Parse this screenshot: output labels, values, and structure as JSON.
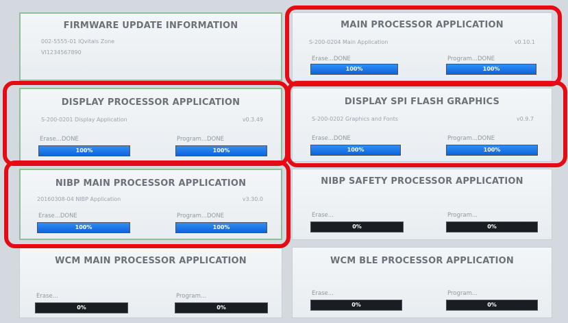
{
  "panels": [
    {
      "id": "firmware",
      "title": "FIRMWARE UPDATE INFORMATION",
      "line1": "002-5555-01 IQvitals Zone",
      "line2": "VI1234567890"
    },
    {
      "id": "main",
      "title": "MAIN PROCESSOR APPLICATION",
      "part": "S-200-0204  Main Application",
      "version": "v0.10.1",
      "erase_label": "Erase...DONE",
      "program_label": "Program...DONE",
      "erase_progress": 100,
      "program_progress": 100,
      "erase_text": "100%",
      "program_text": "100%"
    },
    {
      "id": "display",
      "title": "DISPLAY PROCESSOR APPLICATION",
      "part": "S-200-0201  Display Application",
      "version": "v0.3.49",
      "erase_label": "Erase...DONE",
      "program_label": "Program...DONE",
      "erase_progress": 100,
      "program_progress": 100,
      "erase_text": "100%",
      "program_text": "100%"
    },
    {
      "id": "spiflash",
      "title": "DISPLAY SPI FLASH GRAPHICS",
      "part": "S-200-0202  Graphics and Fonts",
      "version": "v0.9.7",
      "erase_label": "Erase...DONE",
      "program_label": "Program...DONE",
      "erase_progress": 100,
      "program_progress": 100,
      "erase_text": "100%",
      "program_text": "100%"
    },
    {
      "id": "nibpmain",
      "title": "NIBP MAIN PROCESSOR APPLICATION",
      "part": "20160308-04 NIBP Application",
      "version": "v3.30.0",
      "erase_label": "Erase...DONE",
      "program_label": "Program...DONE",
      "erase_progress": 100,
      "program_progress": 100,
      "erase_text": "100%",
      "program_text": "100%"
    },
    {
      "id": "nibpsafety",
      "title": "NIBP SAFETY PROCESSOR APPLICATION",
      "erase_label": "Erase...",
      "program_label": "Program...",
      "erase_progress": 0,
      "program_progress": 0,
      "erase_text": "0%",
      "program_text": "0%"
    },
    {
      "id": "wcmmain",
      "title": "WCM MAIN PROCESSOR APPLICATION",
      "erase_label": "Erase...",
      "program_label": "Program...",
      "erase_progress": 0,
      "program_progress": 0,
      "erase_text": "0%",
      "program_text": "0%"
    },
    {
      "id": "wcmble",
      "title": "WCM BLE PROCESSOR APPLICATION",
      "erase_label": "Erase...",
      "program_label": "Program...",
      "erase_progress": 0,
      "program_progress": 0,
      "erase_text": "0%",
      "program_text": "0%"
    }
  ],
  "colors": {
    "progress_fill": "#1a73e8",
    "progress_empty": "#1a1d22",
    "highlight": "#e40b14",
    "panel_border_green": "#8fbf95"
  }
}
